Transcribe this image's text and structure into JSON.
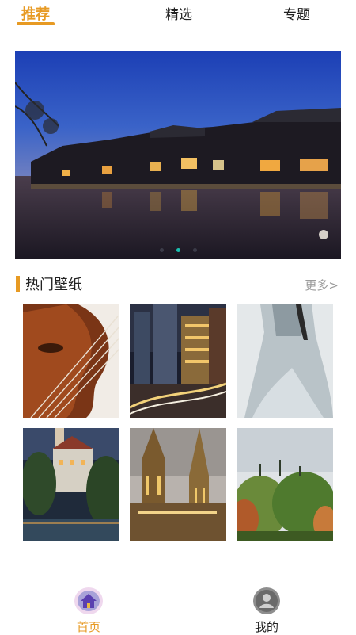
{
  "tabs": [
    {
      "label": "推荐",
      "active": true
    },
    {
      "label": "精选",
      "active": false
    },
    {
      "label": "专题",
      "active": false
    }
  ],
  "banner": {
    "page_count": 3,
    "active_page": 2
  },
  "section": {
    "title": "热门壁纸",
    "more": "更多>"
  },
  "wallpapers": [
    {
      "subject": "violin"
    },
    {
      "subject": "city-night"
    },
    {
      "subject": "dress"
    },
    {
      "subject": "castle-lake"
    },
    {
      "subject": "cathedral"
    },
    {
      "subject": "trees"
    }
  ],
  "bottom_nav": [
    {
      "label": "首页",
      "icon": "home-icon",
      "active": true
    },
    {
      "label": "我的",
      "icon": "profile-icon",
      "active": false
    }
  ],
  "colors": {
    "accent": "#e79a23",
    "dot_active": "#1bbfb0"
  }
}
